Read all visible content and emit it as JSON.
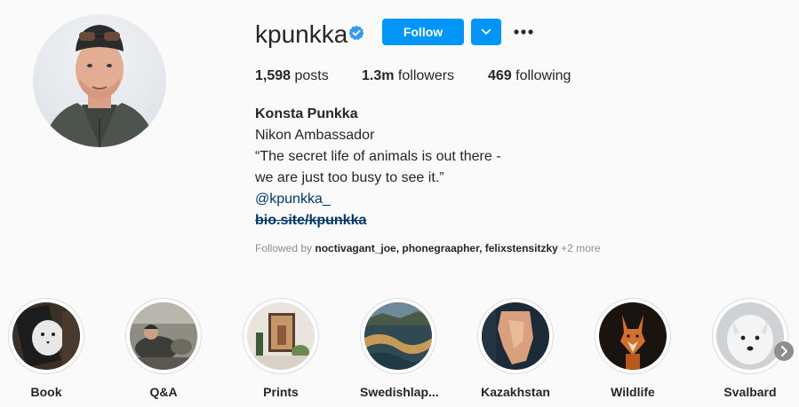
{
  "profile": {
    "username": "kpunkka",
    "follow_label": "Follow",
    "posts_count": "1,598",
    "posts_label": "posts",
    "followers_count": "1.3m",
    "followers_label": "followers",
    "following_count": "469",
    "following_label": "following",
    "full_name": "Konsta Punkka",
    "bio_line1": "Nikon Ambassador",
    "bio_line2": "“The secret life of animals is out there -",
    "bio_line3": "we are just too busy to see it.”",
    "bio_handle": "@kpunkka_",
    "bio_link": "bio.site/kpunkka",
    "followed_by_prefix": "Followed by",
    "followed_by_users": "noctivagant_joe, phonegraapher, felixstensitzky",
    "followed_by_more": "+2 more"
  },
  "colors": {
    "accent": "#0095f6",
    "link": "#00376b",
    "muted": "#8e8e8e",
    "verified": "#3897f0"
  },
  "icons": {
    "verified": "verified-badge-icon",
    "dropdown": "chevron-down-icon",
    "more": "more-options-icon",
    "next": "chevron-right-icon"
  },
  "highlights": [
    {
      "label": "Book"
    },
    {
      "label": "Q&A"
    },
    {
      "label": "Prints"
    },
    {
      "label": "Swedishlap..."
    },
    {
      "label": "Kazakhstan"
    },
    {
      "label": "Wildlife"
    },
    {
      "label": "Svalbard"
    }
  ]
}
